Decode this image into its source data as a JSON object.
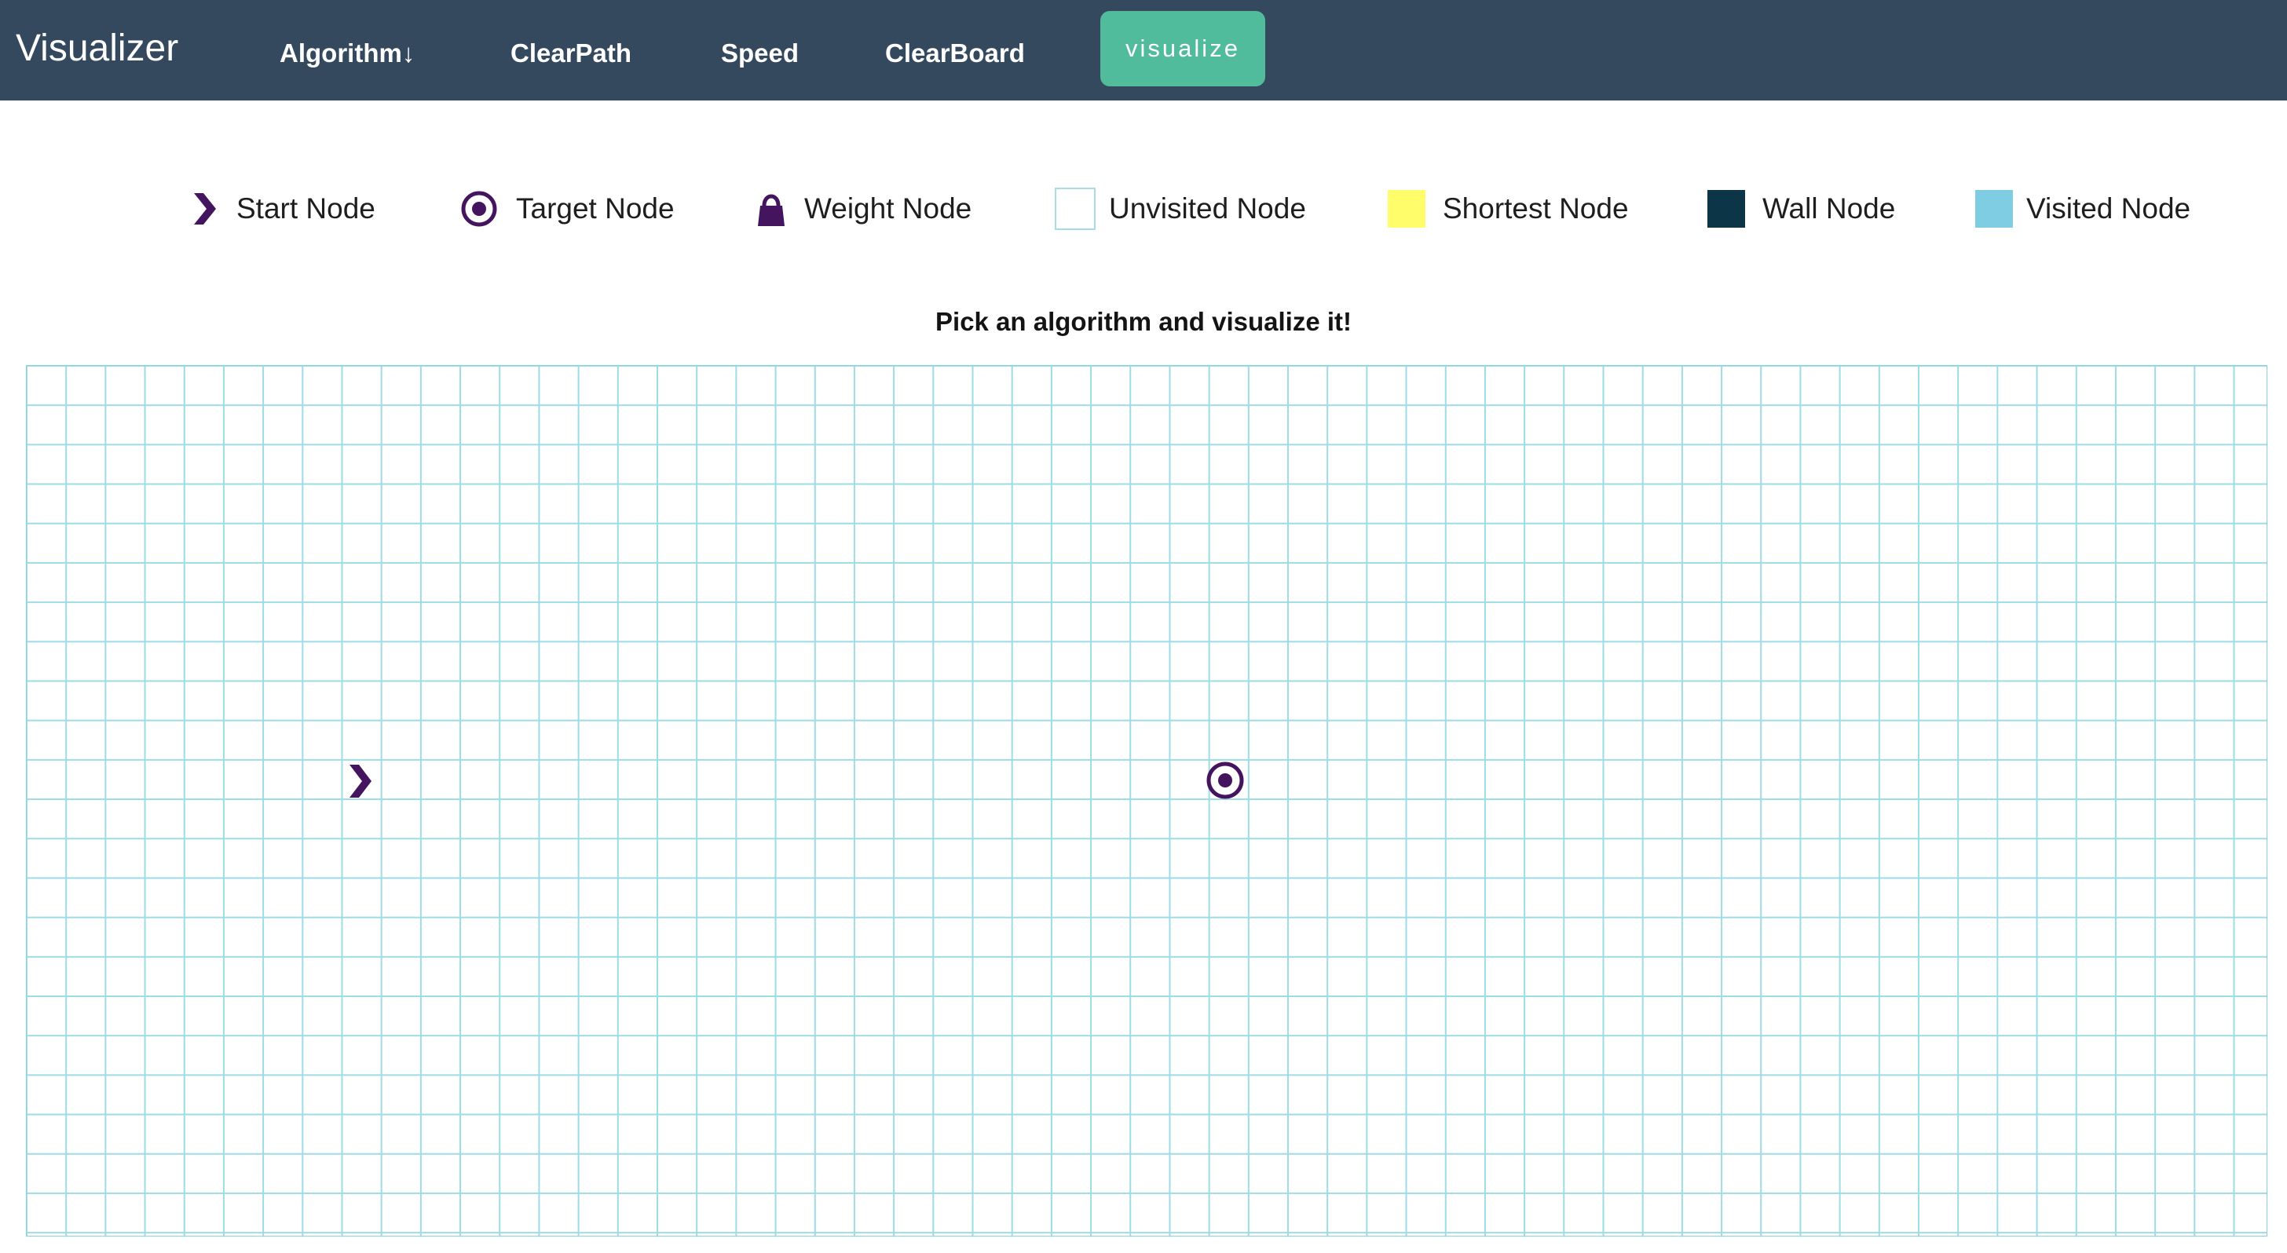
{
  "navbar": {
    "brand": "Visualizer",
    "items": [
      {
        "label": "Algorithm↓"
      },
      {
        "label": "ClearPath"
      },
      {
        "label": "Speed"
      },
      {
        "label": "ClearBoard"
      }
    ],
    "visualize_label": "visualize"
  },
  "legend": {
    "items": [
      {
        "label": "Start Node",
        "icon": "chevron-right-icon"
      },
      {
        "label": "Target Node",
        "icon": "target-icon"
      },
      {
        "label": "Weight Node",
        "icon": "weight-icon"
      },
      {
        "label": "Unvisited Node",
        "icon": "unvisited-swatch",
        "color": "#ffffff"
      },
      {
        "label": "Shortest Node",
        "icon": "shortest-swatch",
        "color": "#fffe6a"
      },
      {
        "label": "Wall Node",
        "icon": "wall-swatch",
        "color": "#0c3547"
      },
      {
        "label": "Visited Node",
        "icon": "visited-swatch",
        "color": "#7fcde3"
      }
    ]
  },
  "message": "Pick an algorithm and visualize it!",
  "colors": {
    "navbar": "#34495e",
    "accent": "#50bc9b",
    "icon": "#44145f",
    "grid_line": "#9ddbe6"
  }
}
